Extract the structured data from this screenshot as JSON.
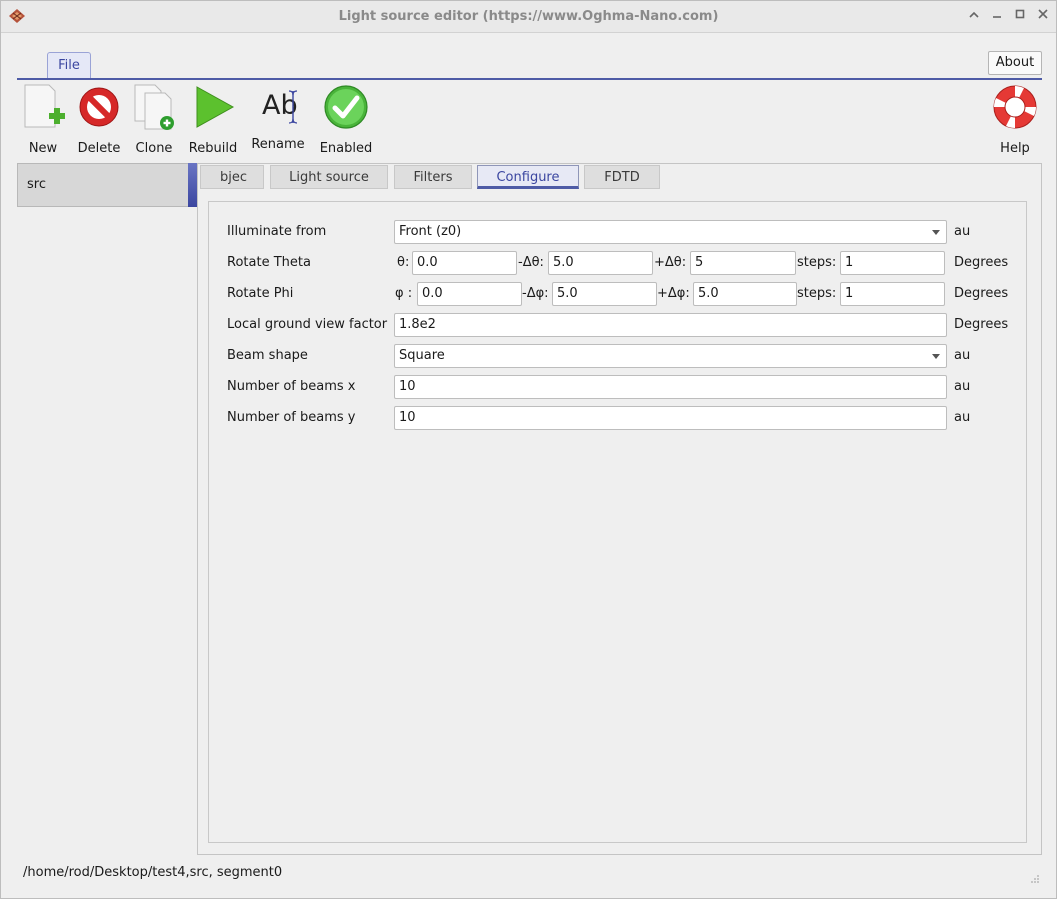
{
  "window": {
    "title": "Light source editor (https://www.Oghma-Nano.com)"
  },
  "ribbon": {
    "file_tab": "File",
    "about_button": "About"
  },
  "toolbar": {
    "new": "New",
    "delete": "Delete",
    "clone": "Clone",
    "rebuild": "Rebuild",
    "rename": "Rename",
    "rename_glyph": "Ab",
    "enabled": "Enabled",
    "help": "Help"
  },
  "sidebar": {
    "items": [
      {
        "label": "src"
      }
    ]
  },
  "tabs": {
    "objects": "bjec",
    "light_source": "Light source",
    "filters": "Filters",
    "configure": "Configure",
    "fdtd": "FDTD",
    "active": "Configure"
  },
  "form": {
    "illuminate_from": {
      "label": "Illuminate from",
      "value": "Front (z0)",
      "unit": "au"
    },
    "rotate_theta": {
      "label": "Rotate Theta",
      "sym": "θ:",
      "value": "0.0",
      "minus_label": "-Δθ:",
      "minus_value": "5.0",
      "plus_label": "+Δθ:",
      "plus_value": "5",
      "steps_label": "steps:",
      "steps_value": "1",
      "unit": "Degrees"
    },
    "rotate_phi": {
      "label": "Rotate Phi",
      "sym": "φ :",
      "value": "0.0",
      "minus_label": "-Δφ:",
      "minus_value": "5.0",
      "plus_label": "+Δφ:",
      "plus_value": "5.0",
      "steps_label": "steps:",
      "steps_value": "1",
      "unit": "Degrees"
    },
    "ground_view_factor": {
      "label": "Local ground view factor",
      "value": "1.8e2",
      "unit": "Degrees"
    },
    "beam_shape": {
      "label": "Beam shape",
      "value": "Square",
      "unit": "au"
    },
    "beams_x": {
      "label": "Number of beams x",
      "value": "10",
      "unit": "au"
    },
    "beams_y": {
      "label": "Number of beams y",
      "value": "10",
      "unit": "au"
    }
  },
  "status": {
    "path": "/home/rod/Desktop/test4,src, segment0"
  }
}
